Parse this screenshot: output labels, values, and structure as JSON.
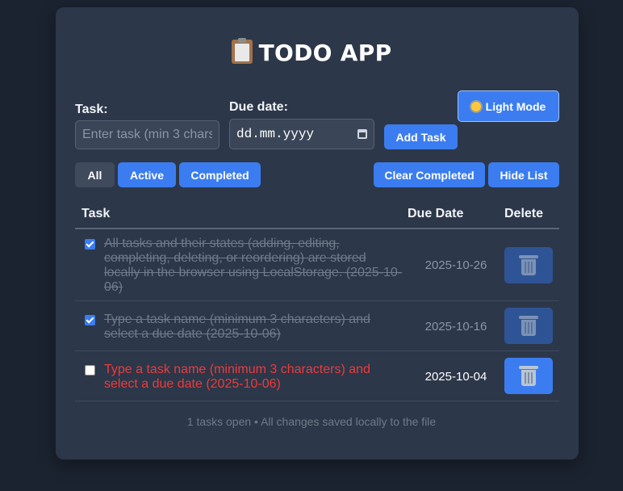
{
  "app": {
    "title": "TODO APP",
    "icon": "clipboard-icon"
  },
  "form": {
    "task_label": "Task:",
    "task_placeholder": "Enter task (min 3 chars)",
    "task_value": "",
    "due_label": "Due date:",
    "due_placeholder": "dd.mm.yyyy",
    "add_button": "Add Task",
    "theme_button": "Light Mode",
    "theme_icon": "sun-icon"
  },
  "filters": {
    "all": "All",
    "active": "Active",
    "completed": "Completed",
    "selected": "All"
  },
  "actions": {
    "clear_completed": "Clear Completed",
    "hide_list": "Hide List"
  },
  "table": {
    "headers": {
      "task": "Task",
      "due_date": "Due Date",
      "delete": "Delete"
    },
    "rows": [
      {
        "checked": true,
        "text": "All tasks and their states (adding, editing, completing, deleting, or reordering) are stored locally in the browser using LocalStorage. (2025-10-06)",
        "due_date": "2025-10-26",
        "delete_icon": "trash-icon"
      },
      {
        "checked": true,
        "text": "Type a task name (minimum 3 characters) and select a due date (2025-10-06)",
        "due_date": "2025-10-16",
        "delete_icon": "trash-icon"
      },
      {
        "checked": false,
        "text": "Type a task name (minimum 3 characters) and select a due date (2025-10-06)",
        "due_date": "2025-10-04",
        "delete_icon": "trash-icon"
      }
    ]
  },
  "footer": {
    "status": "1 tasks open • All changes saved locally to the file"
  },
  "colors": {
    "background": "#1b2330",
    "card": "#2c3749",
    "accent": "#3b7df0",
    "overdue": "#ef3a3a",
    "muted": "#6f7a8a"
  }
}
